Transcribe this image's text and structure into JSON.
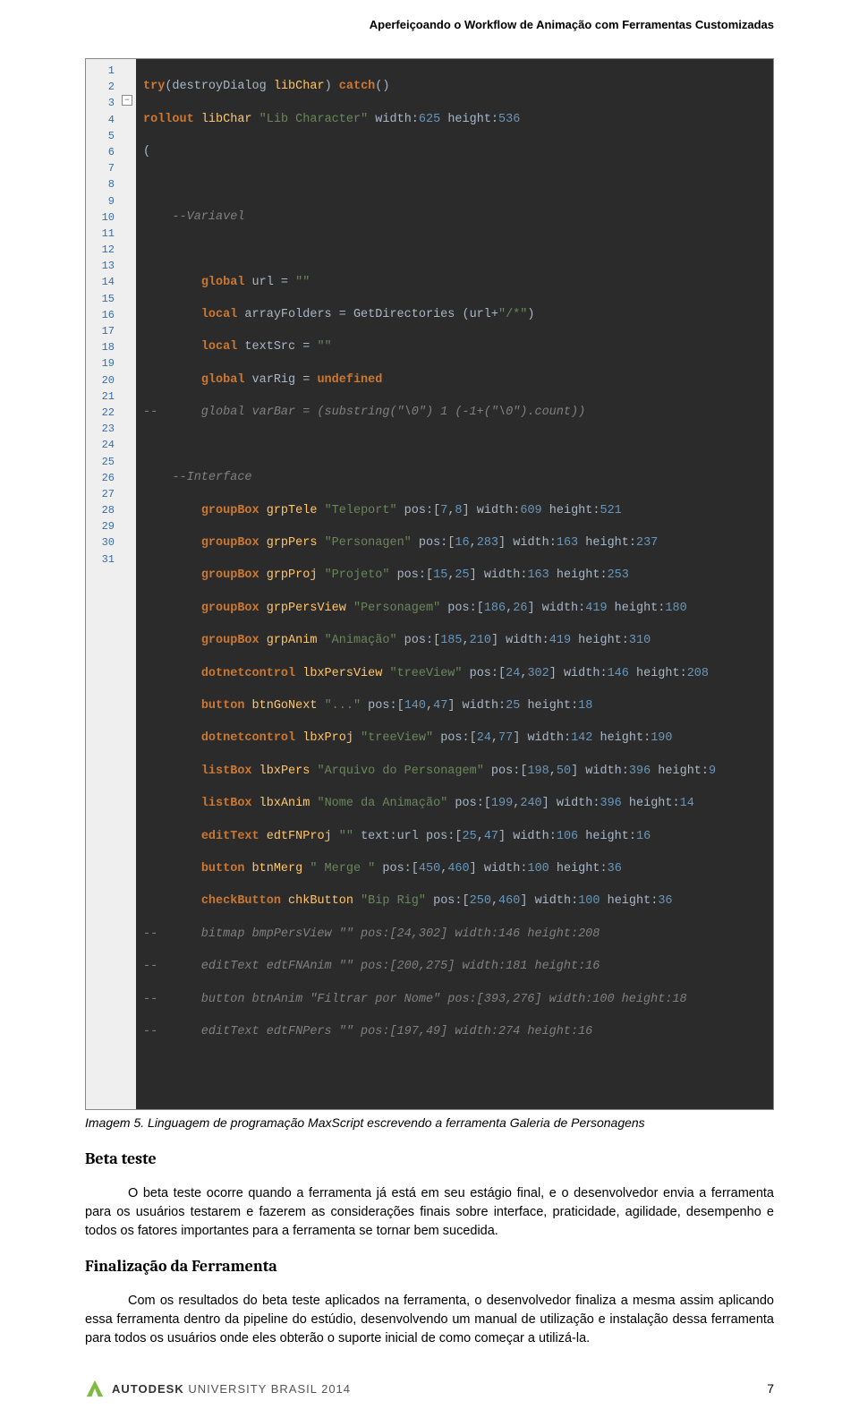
{
  "header": {
    "title": "Aperfeiçoando o Workflow de Animação com Ferramentas Customizadas"
  },
  "code": {
    "line_numbers": [
      "1",
      "2",
      "3",
      "4",
      "5",
      "6",
      "7",
      "8",
      "9",
      "10",
      "11",
      "12",
      "13",
      "14",
      "15",
      "16",
      "17",
      "18",
      "19",
      "20",
      "21",
      "22",
      "23",
      "24",
      "25",
      "26",
      "27",
      "28",
      "29",
      "30",
      "31"
    ],
    "fold_at": 3
  },
  "caption": "Imagem 5. Linguagem de programação MaxScript escrevendo a ferramenta Galeria de Personagens",
  "section1": {
    "heading": "Beta teste",
    "para": "O beta teste ocorre quando a ferramenta já está em seu estágio final, e o desenvolvedor envia a ferramenta para os usuários testarem e fazerem as considerações finais sobre interface, praticidade, agilidade, desempenho e todos os fatores importantes para a ferramenta se tornar bem sucedida."
  },
  "section2": {
    "heading": "Finalização  da Ferramenta",
    "para": "Com os resultados do beta teste aplicados na ferramenta, o desenvolvedor finaliza a mesma assim aplicando essa ferramenta dentro da pipeline do estúdio, desenvolvendo um manual de utilização e instalação dessa ferramenta para todos os usuários onde eles obterão o suporte inicial de como começar a utilizá-la."
  },
  "footer": {
    "brand": "AUTODESK",
    "subbrand": " UNIVERSITY BRASIL 2014",
    "page": "7"
  }
}
